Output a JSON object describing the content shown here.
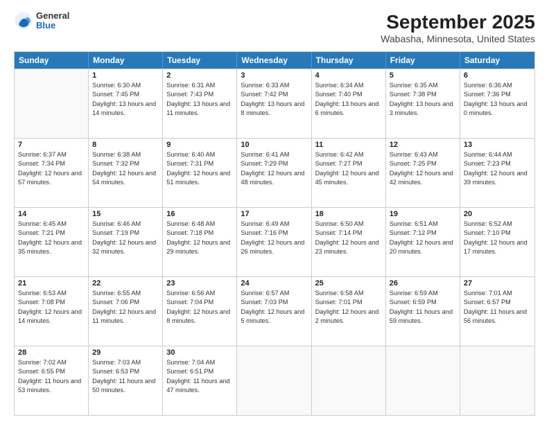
{
  "header": {
    "logo_general": "General",
    "logo_blue": "Blue",
    "title": "September 2025",
    "subtitle": "Wabasha, Minnesota, United States"
  },
  "days_of_week": [
    "Sunday",
    "Monday",
    "Tuesday",
    "Wednesday",
    "Thursday",
    "Friday",
    "Saturday"
  ],
  "weeks": [
    [
      {
        "day": "",
        "sunrise": "",
        "sunset": "",
        "daylight": ""
      },
      {
        "day": "1",
        "sunrise": "Sunrise: 6:30 AM",
        "sunset": "Sunset: 7:45 PM",
        "daylight": "Daylight: 13 hours and 14 minutes."
      },
      {
        "day": "2",
        "sunrise": "Sunrise: 6:31 AM",
        "sunset": "Sunset: 7:43 PM",
        "daylight": "Daylight: 13 hours and 11 minutes."
      },
      {
        "day": "3",
        "sunrise": "Sunrise: 6:33 AM",
        "sunset": "Sunset: 7:42 PM",
        "daylight": "Daylight: 13 hours and 8 minutes."
      },
      {
        "day": "4",
        "sunrise": "Sunrise: 6:34 AM",
        "sunset": "Sunset: 7:40 PM",
        "daylight": "Daylight: 13 hours and 6 minutes."
      },
      {
        "day": "5",
        "sunrise": "Sunrise: 6:35 AM",
        "sunset": "Sunset: 7:38 PM",
        "daylight": "Daylight: 13 hours and 3 minutes."
      },
      {
        "day": "6",
        "sunrise": "Sunrise: 6:36 AM",
        "sunset": "Sunset: 7:36 PM",
        "daylight": "Daylight: 13 hours and 0 minutes."
      }
    ],
    [
      {
        "day": "7",
        "sunrise": "Sunrise: 6:37 AM",
        "sunset": "Sunset: 7:34 PM",
        "daylight": "Daylight: 12 hours and 57 minutes."
      },
      {
        "day": "8",
        "sunrise": "Sunrise: 6:38 AM",
        "sunset": "Sunset: 7:32 PM",
        "daylight": "Daylight: 12 hours and 54 minutes."
      },
      {
        "day": "9",
        "sunrise": "Sunrise: 6:40 AM",
        "sunset": "Sunset: 7:31 PM",
        "daylight": "Daylight: 12 hours and 51 minutes."
      },
      {
        "day": "10",
        "sunrise": "Sunrise: 6:41 AM",
        "sunset": "Sunset: 7:29 PM",
        "daylight": "Daylight: 12 hours and 48 minutes."
      },
      {
        "day": "11",
        "sunrise": "Sunrise: 6:42 AM",
        "sunset": "Sunset: 7:27 PM",
        "daylight": "Daylight: 12 hours and 45 minutes."
      },
      {
        "day": "12",
        "sunrise": "Sunrise: 6:43 AM",
        "sunset": "Sunset: 7:25 PM",
        "daylight": "Daylight: 12 hours and 42 minutes."
      },
      {
        "day": "13",
        "sunrise": "Sunrise: 6:44 AM",
        "sunset": "Sunset: 7:23 PM",
        "daylight": "Daylight: 12 hours and 39 minutes."
      }
    ],
    [
      {
        "day": "14",
        "sunrise": "Sunrise: 6:45 AM",
        "sunset": "Sunset: 7:21 PM",
        "daylight": "Daylight: 12 hours and 35 minutes."
      },
      {
        "day": "15",
        "sunrise": "Sunrise: 6:46 AM",
        "sunset": "Sunset: 7:19 PM",
        "daylight": "Daylight: 12 hours and 32 minutes."
      },
      {
        "day": "16",
        "sunrise": "Sunrise: 6:48 AM",
        "sunset": "Sunset: 7:18 PM",
        "daylight": "Daylight: 12 hours and 29 minutes."
      },
      {
        "day": "17",
        "sunrise": "Sunrise: 6:49 AM",
        "sunset": "Sunset: 7:16 PM",
        "daylight": "Daylight: 12 hours and 26 minutes."
      },
      {
        "day": "18",
        "sunrise": "Sunrise: 6:50 AM",
        "sunset": "Sunset: 7:14 PM",
        "daylight": "Daylight: 12 hours and 23 minutes."
      },
      {
        "day": "19",
        "sunrise": "Sunrise: 6:51 AM",
        "sunset": "Sunset: 7:12 PM",
        "daylight": "Daylight: 12 hours and 20 minutes."
      },
      {
        "day": "20",
        "sunrise": "Sunrise: 6:52 AM",
        "sunset": "Sunset: 7:10 PM",
        "daylight": "Daylight: 12 hours and 17 minutes."
      }
    ],
    [
      {
        "day": "21",
        "sunrise": "Sunrise: 6:53 AM",
        "sunset": "Sunset: 7:08 PM",
        "daylight": "Daylight: 12 hours and 14 minutes."
      },
      {
        "day": "22",
        "sunrise": "Sunrise: 6:55 AM",
        "sunset": "Sunset: 7:06 PM",
        "daylight": "Daylight: 12 hours and 11 minutes."
      },
      {
        "day": "23",
        "sunrise": "Sunrise: 6:56 AM",
        "sunset": "Sunset: 7:04 PM",
        "daylight": "Daylight: 12 hours and 8 minutes."
      },
      {
        "day": "24",
        "sunrise": "Sunrise: 6:57 AM",
        "sunset": "Sunset: 7:03 PM",
        "daylight": "Daylight: 12 hours and 5 minutes."
      },
      {
        "day": "25",
        "sunrise": "Sunrise: 6:58 AM",
        "sunset": "Sunset: 7:01 PM",
        "daylight": "Daylight: 12 hours and 2 minutes."
      },
      {
        "day": "26",
        "sunrise": "Sunrise: 6:59 AM",
        "sunset": "Sunset: 6:59 PM",
        "daylight": "Daylight: 11 hours and 59 minutes."
      },
      {
        "day": "27",
        "sunrise": "Sunrise: 7:01 AM",
        "sunset": "Sunset: 6:57 PM",
        "daylight": "Daylight: 11 hours and 56 minutes."
      }
    ],
    [
      {
        "day": "28",
        "sunrise": "Sunrise: 7:02 AM",
        "sunset": "Sunset: 6:55 PM",
        "daylight": "Daylight: 11 hours and 53 minutes."
      },
      {
        "day": "29",
        "sunrise": "Sunrise: 7:03 AM",
        "sunset": "Sunset: 6:53 PM",
        "daylight": "Daylight: 11 hours and 50 minutes."
      },
      {
        "day": "30",
        "sunrise": "Sunrise: 7:04 AM",
        "sunset": "Sunset: 6:51 PM",
        "daylight": "Daylight: 11 hours and 47 minutes."
      },
      {
        "day": "",
        "sunrise": "",
        "sunset": "",
        "daylight": ""
      },
      {
        "day": "",
        "sunrise": "",
        "sunset": "",
        "daylight": ""
      },
      {
        "day": "",
        "sunrise": "",
        "sunset": "",
        "daylight": ""
      },
      {
        "day": "",
        "sunrise": "",
        "sunset": "",
        "daylight": ""
      }
    ]
  ]
}
